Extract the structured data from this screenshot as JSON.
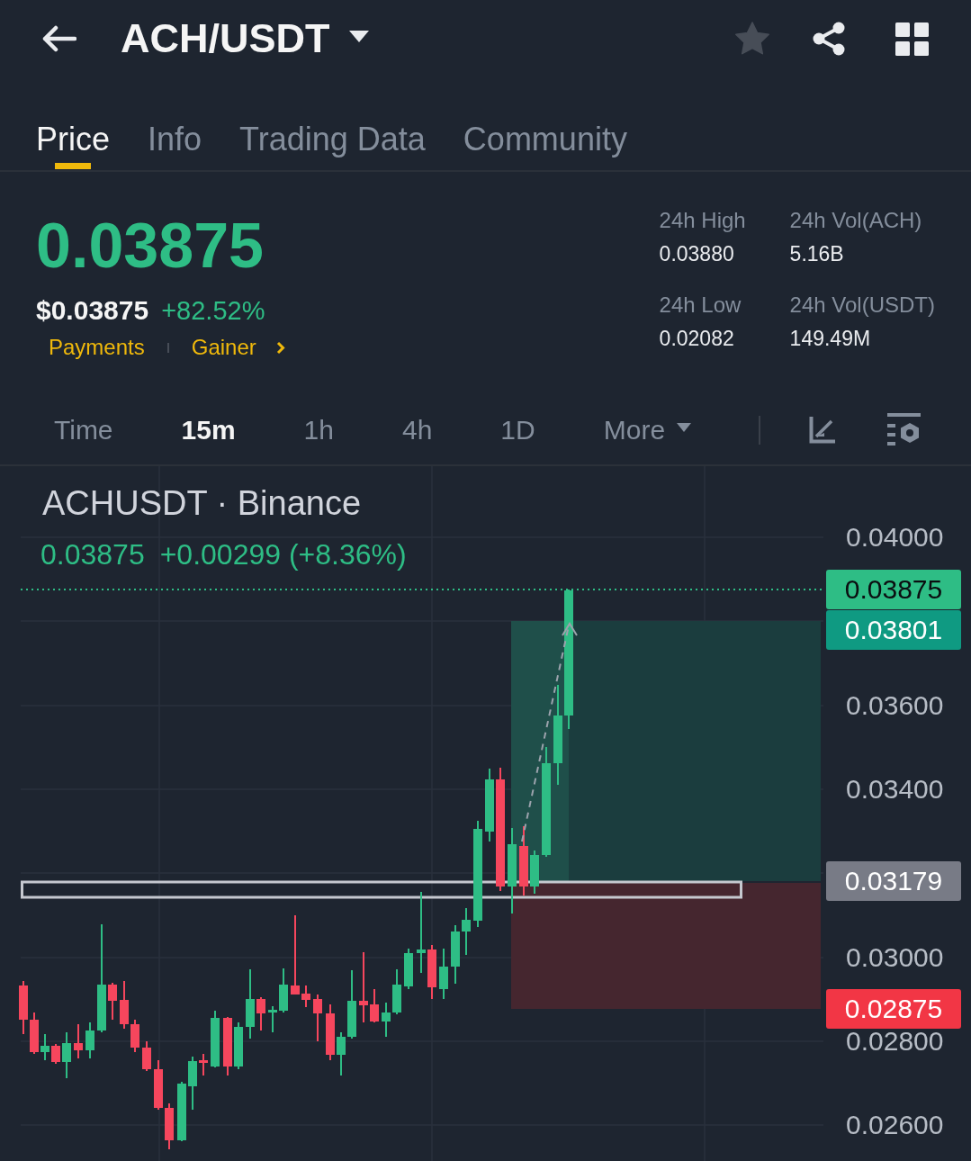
{
  "header": {
    "title": "ACH/USDT",
    "favorite": false
  },
  "tabs": [
    {
      "label": "Price",
      "selected": true
    },
    {
      "label": "Info",
      "selected": false
    },
    {
      "label": "Trading Data",
      "selected": false
    },
    {
      "label": "Community",
      "selected": false
    }
  ],
  "ticker": {
    "price": "0.03875",
    "usd_price": "$0.03875",
    "change": "+82.52%",
    "tags": [
      "Payments",
      "Gainer"
    ],
    "stats": [
      {
        "label": "24h High",
        "value": "0.03880"
      },
      {
        "label": "24h Vol(ACH)",
        "value": "5.16B"
      },
      {
        "label": "24h Low",
        "value": "0.02082"
      },
      {
        "label": "24h Vol(USDT)",
        "value": "149.49M"
      }
    ]
  },
  "intervals": [
    {
      "label": "Time",
      "kind": "option",
      "selected": false
    },
    {
      "label": "15m",
      "kind": "option",
      "selected": true
    },
    {
      "label": "1h",
      "kind": "option",
      "selected": false
    },
    {
      "label": "4h",
      "kind": "option",
      "selected": false
    },
    {
      "label": "1D",
      "kind": "option",
      "selected": false
    },
    {
      "label": "More",
      "kind": "menu",
      "selected": false
    }
  ],
  "chart": {
    "symbol": "ACHUSDT · Binance",
    "last": "0.03875",
    "change": "+0.00299 (+8.36%)",
    "y_axis": [
      "0.04000",
      "0.03600",
      "0.03400",
      "0.03000",
      "0.02800",
      "0.02600"
    ],
    "price_tags": [
      {
        "label": "0.03875",
        "color": "#2ebd85"
      },
      {
        "label": "0.03801",
        "color": "#0f9a82"
      },
      {
        "label": "0.03179",
        "color": "#787b86"
      },
      {
        "label": "0.02875",
        "color": "#f23645"
      }
    ]
  }
}
